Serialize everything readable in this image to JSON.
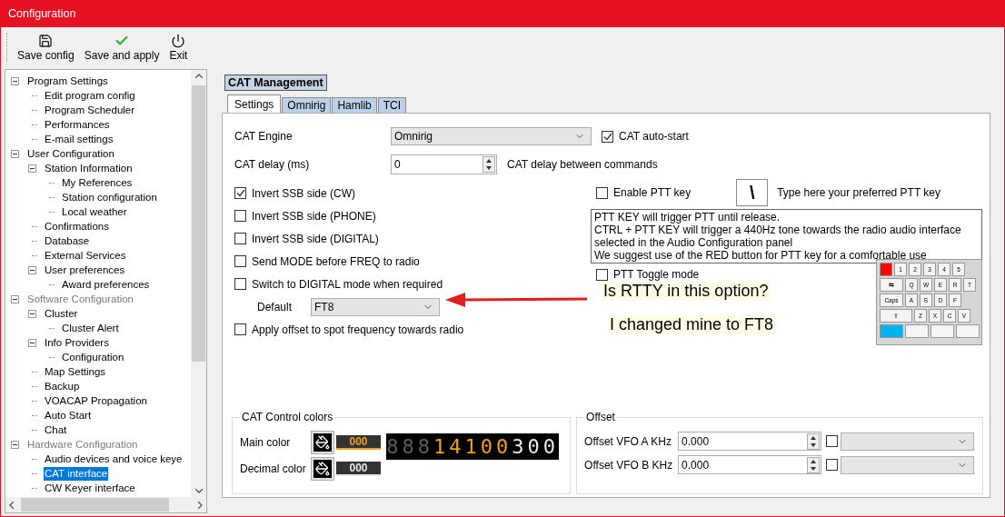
{
  "window": {
    "title": "Configuration"
  },
  "toolbar": [
    {
      "kind": "save",
      "label": "Save config"
    },
    {
      "kind": "apply",
      "label": "Save and apply"
    },
    {
      "kind": "exit",
      "label": "Exit"
    }
  ],
  "tree": [
    {
      "label": "Program Settings",
      "dimmed": false,
      "selected": false,
      "children": [
        {
          "label": "Edit program config",
          "selected": false
        },
        {
          "label": "Program Scheduler",
          "selected": false
        },
        {
          "label": "Performances",
          "selected": false
        },
        {
          "label": "E-mail settings",
          "selected": false
        }
      ]
    },
    {
      "label": "User Configuration",
      "dimmed": false,
      "selected": false,
      "children": [
        {
          "label": "Station Information",
          "selected": false,
          "children": [
            {
              "label": "My References",
              "selected": false
            },
            {
              "label": "Station configuration",
              "selected": false
            },
            {
              "label": "Local weather",
              "selected": false
            }
          ]
        },
        {
          "label": "Confirmations",
          "selected": false
        },
        {
          "label": "Database",
          "selected": false
        },
        {
          "label": "External Services",
          "selected": false
        },
        {
          "label": "User preferences",
          "selected": false,
          "children": [
            {
              "label": "Award preferences",
              "selected": false
            }
          ]
        }
      ]
    },
    {
      "label": "Software Configuration",
      "dimmed": true,
      "selected": false,
      "children": [
        {
          "label": "Cluster",
          "selected": false,
          "children": [
            {
              "label": "Cluster Alert",
              "selected": false
            }
          ]
        },
        {
          "label": "Info Providers",
          "selected": false,
          "children": [
            {
              "label": "Configuration",
              "selected": false
            }
          ]
        },
        {
          "label": "Map Settings",
          "selected": false
        },
        {
          "label": "Backup",
          "selected": false
        },
        {
          "label": "VOACAP Propagation",
          "selected": false
        },
        {
          "label": "Auto Start",
          "selected": false
        },
        {
          "label": "Chat",
          "selected": false
        }
      ]
    },
    {
      "label": "Hardware Configuration",
      "dimmed": true,
      "selected": false,
      "children": [
        {
          "label": "Audio devices and voice keye",
          "selected": false
        },
        {
          "label": "CAT interface",
          "selected": true
        },
        {
          "label": "CW Keyer interface",
          "selected": false
        }
      ]
    }
  ],
  "section_title": "CAT Management",
  "tabs": [
    {
      "label": "Settings",
      "selected": true
    },
    {
      "label": "Omnirig",
      "selected": false
    },
    {
      "label": "Hamlib",
      "selected": false
    },
    {
      "label": "TCI",
      "selected": false
    }
  ],
  "settings": {
    "cat_engine": {
      "label": "CAT Engine",
      "value": "Omnirig"
    },
    "cat_auto_start": {
      "label": "CAT auto-start",
      "checked": true
    },
    "cat_delay": {
      "label": "CAT delay (ms)",
      "value": "0",
      "hint": "CAT delay between commands"
    },
    "options": [
      {
        "label": "Invert SSB side (CW)",
        "checked": true
      },
      {
        "label": "Invert SSB side (PHONE)",
        "checked": false
      },
      {
        "label": "Invert SSB side (DIGITAL)",
        "checked": false
      },
      {
        "label": "Send MODE before FREQ to radio",
        "checked": false
      },
      {
        "label": "Switch to DIGITAL mode when required",
        "checked": false
      }
    ],
    "default_mode": {
      "label": "Default",
      "value": "FT8"
    },
    "apply_offset": {
      "label": "Apply offset to spot frequency towards radio",
      "checked": false
    },
    "ptt": {
      "enable": {
        "label": "Enable PTT key",
        "checked": false
      },
      "key": "\\",
      "hint": "Type here your preferred PTT key",
      "info": [
        "PTT KEY will trigger PTT until release.",
        "CTRL + PTT KEY will trigger a 440Hz tone towards the radio audio interface",
        "selected in the Audio Configuration panel",
        "We suggest use of the RED button for PTT key for a comfortable use"
      ],
      "toggle": {
        "label": "PTT Toggle mode",
        "checked": false
      }
    },
    "keyboard": [
      [
        {
          "kind": "key",
          "color": "#ff0000"
        },
        {
          "kind": "key",
          "label": "1"
        },
        {
          "kind": "key",
          "label": "2"
        },
        {
          "kind": "key",
          "label": "3"
        },
        {
          "kind": "key",
          "label": "4"
        },
        {
          "kind": "key",
          "label": "5"
        }
      ],
      [
        {
          "kind": "wide",
          "label": "⇆"
        },
        {
          "kind": "key",
          "label": "Q"
        },
        {
          "kind": "key",
          "label": "W"
        },
        {
          "kind": "key",
          "label": "E"
        },
        {
          "kind": "key",
          "label": "R"
        },
        {
          "kind": "key",
          "label": "T"
        }
      ],
      [
        {
          "kind": "wide",
          "label": "Caps"
        },
        {
          "kind": "key",
          "label": "A"
        },
        {
          "kind": "key",
          "label": "S"
        },
        {
          "kind": "key",
          "label": "D"
        },
        {
          "kind": "key",
          "label": "F"
        }
      ],
      [
        {
          "kind": "wider",
          "label": "⇧"
        },
        {
          "kind": "key",
          "label": "Z"
        },
        {
          "kind": "key",
          "label": "X"
        },
        {
          "kind": "key",
          "label": "C"
        },
        {
          "kind": "key",
          "label": "V"
        }
      ],
      [
        {
          "kind": "wide",
          "color": "#00b4ef"
        },
        {
          "kind": "wide"
        },
        {
          "kind": "wide"
        },
        {
          "kind": "wide"
        }
      ]
    ]
  },
  "colors_group": {
    "title": "CAT Control colors",
    "rows": [
      {
        "label": "Main color",
        "value": "000",
        "color": "#f0a020"
      },
      {
        "label": "Decimal color",
        "value": "000",
        "color": "#e8e8e8"
      }
    ],
    "display": [
      {
        "char": "8",
        "kind": "dim"
      },
      {
        "char": "8",
        "kind": "dim"
      },
      {
        "char": "8",
        "kind": "dim"
      },
      {
        "char": "1",
        "kind": "main"
      },
      {
        "char": "4",
        "kind": "main"
      },
      {
        "char": "1",
        "kind": "main"
      },
      {
        "char": "0",
        "kind": "main"
      },
      {
        "char": "0",
        "kind": "main"
      },
      {
        "char": "3",
        "kind": "decimal"
      },
      {
        "char": "0",
        "kind": "decimal"
      },
      {
        "char": "0",
        "kind": "decimal"
      }
    ]
  },
  "offset_group": {
    "title": "Offset",
    "rows": [
      {
        "label": "Offset VFO A KHz",
        "value": "0.000",
        "checked": false
      },
      {
        "label": "Offset VFO B KHz",
        "value": "0.000",
        "checked": false
      }
    ]
  },
  "annotations": [
    "Is RTTY in this option?",
    "I changed mine to FT8"
  ]
}
